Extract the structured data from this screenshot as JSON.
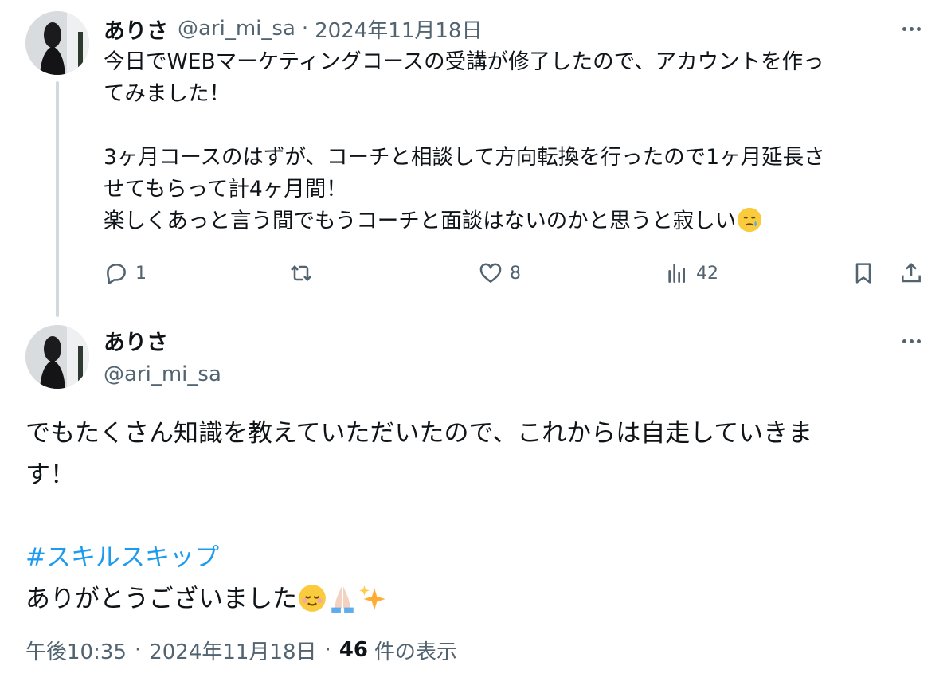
{
  "tweet1": {
    "author_name": "ありさ",
    "handle": "@ari_mi_sa",
    "separator": "·",
    "date": "2024年11月18日",
    "lines": [
      "今日でWEBマーケティングコースの受講が修了したので、アカウントを作っ",
      "てみました！",
      "",
      "3ヶ月コースのはずが、コーチと相談して方向転換を行ったので1ヶ月延長さ",
      "せてもらって計4ヶ月間！",
      "楽しくあっと言う間でもうコーチと面談はないのかと思うと寂しい"
    ],
    "trailing_emoji": "face-holding-back-tears",
    "actions": {
      "reply_count": "1",
      "retweet_count": "",
      "like_count": "8",
      "view_count": "42"
    }
  },
  "tweet2": {
    "author_name": "ありさ",
    "handle": "@ari_mi_sa",
    "lines": [
      "でもたくさん知識を教えていただいたので、これからは自走していきま",
      "す！",
      ""
    ],
    "hashtag": "#スキルスキップ",
    "closing": "ありがとうございました",
    "closing_emojis": [
      "relieved-face",
      "folded-hands",
      "sparkles"
    ],
    "time": "午後10:35",
    "separator": "·",
    "date": "2024年11月18日",
    "views_number": "46",
    "views_label": "件の表示"
  },
  "colors": {
    "text": "#0f1419",
    "secondary": "#536471",
    "link": "#1d9bf0",
    "thread_line": "#cfd9de"
  }
}
